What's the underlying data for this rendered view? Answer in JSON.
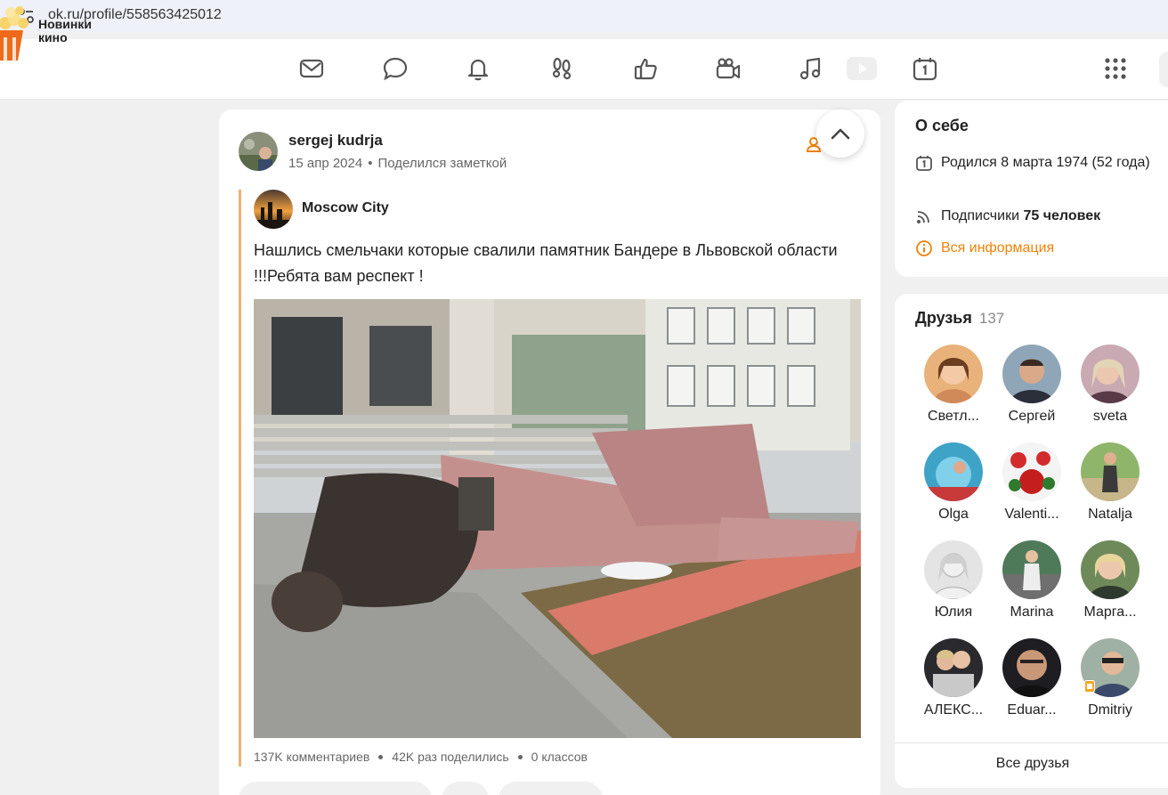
{
  "browser": {
    "url": "ok.ru/profile/558563425012"
  },
  "header": {
    "promo_label": "Новинки кино",
    "nav_icons": [
      "mail-icon",
      "chat-icon",
      "bell-icon",
      "footprints-icon",
      "like-icon",
      "video-camera-icon",
      "music-icon",
      "play-icon",
      "calendar-icon"
    ],
    "apps_icon": "grid-icon"
  },
  "post": {
    "author": "sergej kudrja",
    "date": "15 апр 2024",
    "action": "Поделился заметкой",
    "group_name": "Moscow City",
    "text": "Нашлись смельчаки которые свалили памятник Бандере в Львовской области !!!Ребята вам респект !",
    "stats": {
      "comments": "137K комментариев",
      "shares": "42K раз поделились",
      "classes": "0 классов"
    }
  },
  "about": {
    "title": "О себе",
    "birth": "Родился 8 марта 1974 (52 года)",
    "subscribers_label": "Подписчики ",
    "subscribers_value": "75 человек",
    "all_info": "Вся информация"
  },
  "friends": {
    "title": "Друзья",
    "count": "137",
    "items": [
      {
        "name": "Светл..."
      },
      {
        "name": "Сергей"
      },
      {
        "name": "sveta"
      },
      {
        "name": "Olga"
      },
      {
        "name": "Valenti..."
      },
      {
        "name": "Natalja"
      },
      {
        "name": "Юлия"
      },
      {
        "name": "Marina"
      },
      {
        "name": "Марга..."
      },
      {
        "name": "АЛЕКС..."
      },
      {
        "name": "Eduar..."
      },
      {
        "name": "Dmitriy"
      }
    ],
    "all_label": "Все друзья"
  },
  "colors": {
    "accent": "#ee8208",
    "quote_bar": "#f0b070",
    "background": "#f0f0f0"
  }
}
